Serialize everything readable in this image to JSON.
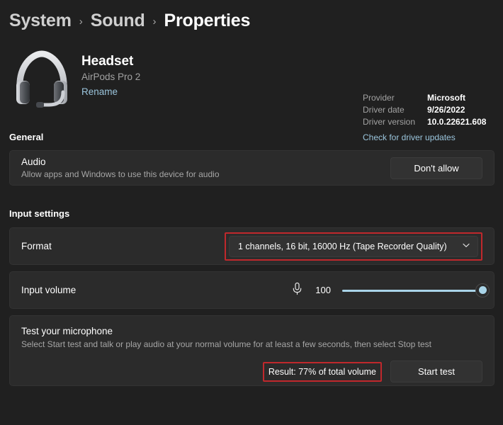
{
  "breadcrumb": {
    "items": [
      {
        "label": "System",
        "current": false
      },
      {
        "label": "Sound",
        "current": false
      },
      {
        "label": "Properties",
        "current": true
      }
    ],
    "separator": "›"
  },
  "device": {
    "icon": "headset-icon",
    "name": "Headset",
    "subtitle": "AirPods Pro 2",
    "rename_label": "Rename"
  },
  "driver": {
    "provider_label": "Provider",
    "provider_value": "Microsoft",
    "date_label": "Driver date",
    "date_value": "9/26/2022",
    "version_label": "Driver version",
    "version_value": "10.0.22621.608",
    "update_link": "Check for driver updates"
  },
  "general": {
    "heading": "General",
    "audio": {
      "title": "Audio",
      "description": "Allow apps and Windows to use this device for audio",
      "button_label": "Don't allow"
    }
  },
  "input_settings": {
    "heading": "Input settings",
    "format": {
      "label": "Format",
      "value": "1 channels, 16 bit, 16000 Hz (Tape Recorder Quality)",
      "chevron": "chevron-down-icon",
      "highlighted": true
    },
    "volume": {
      "label": "Input volume",
      "icon": "microphone-icon",
      "value": "100",
      "percent": 100
    },
    "mic_test": {
      "title": "Test your microphone",
      "description": "Select Start test and talk or play audio at your normal volume for at least a few seconds, then select Stop test",
      "result": "Result: 77% of total volume",
      "result_highlighted": true,
      "button_label": "Start test"
    }
  },
  "colors": {
    "page_background": "#202020",
    "card_background": "#2b2b2b",
    "accent_link": "#9bc5dc",
    "slider_accent": "#a9d4e8",
    "annotation_red": "#c0282c",
    "button_background": "#323232"
  }
}
